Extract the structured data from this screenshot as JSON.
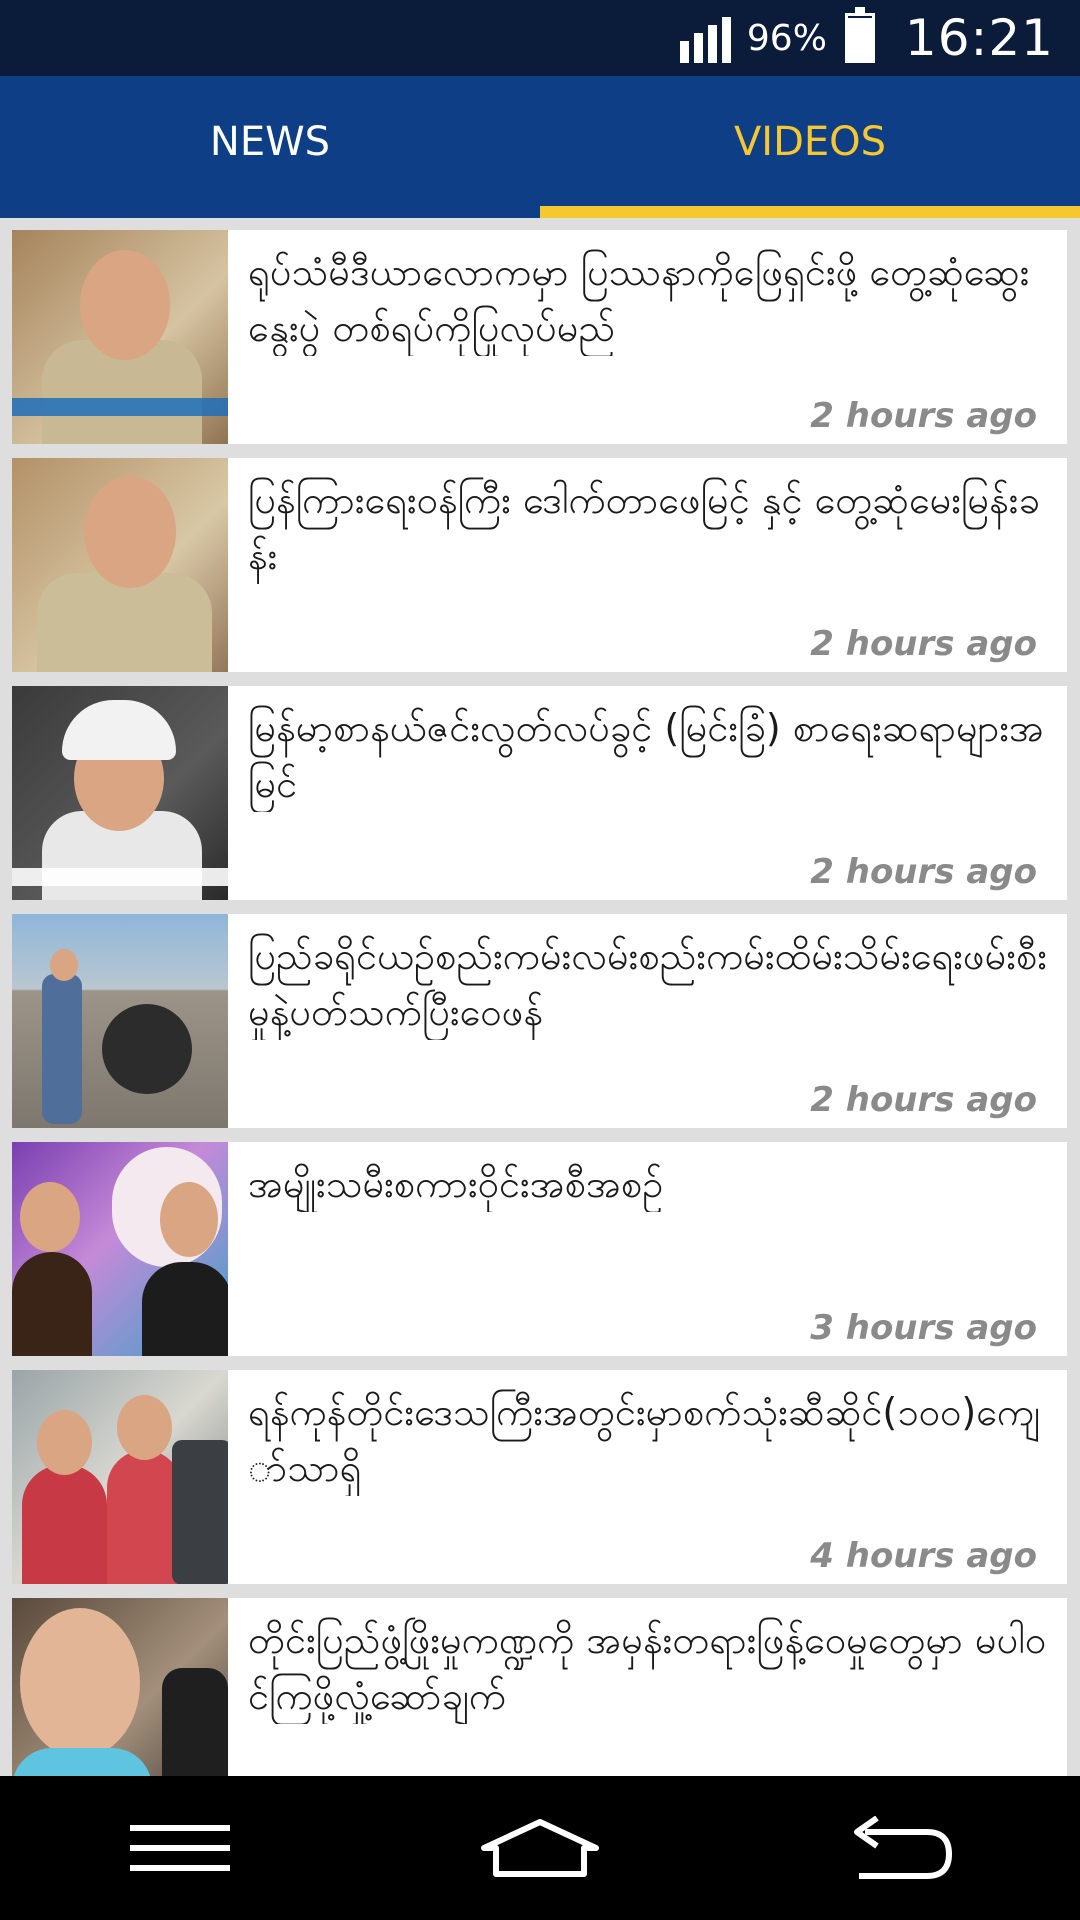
{
  "status_bar": {
    "battery_percent": "96%",
    "time": "16:21",
    "battery_level": 0.96,
    "signal_bars": 4
  },
  "tabs": [
    {
      "label": "NEWS",
      "active": false
    },
    {
      "label": "VIDEOS",
      "active": true
    }
  ],
  "colors": {
    "status_bar_bg": "#0b1c3a",
    "tab_bar_bg": "#0e3e86",
    "accent": "#f7c730",
    "timestamp": "#8a8a8a"
  },
  "videos": [
    {
      "title": "ရုပ်သံမီဒီယာလောကမှာ ပြဿနာကိုဖြေရှင်းဖို့ တွေ့ဆုံဆွေးနွေးပွဲ တစ်ရပ်ကိုပြုလုပ်မည်",
      "time": "2 hours ago"
    },
    {
      "title": "ပြန်ကြားရေးဝန်ကြီး ဒေါက်တာဖေမြင့် နှင့် တွေ့ဆုံမေးမြန်းခန်း",
      "time": "2 hours ago"
    },
    {
      "title": "မြန်မာ့စာနယ်ဇင်းလွတ်လပ်ခွင့် (မြင်းခြံ) စာရေးဆရာများအမြင်",
      "time": "2 hours ago"
    },
    {
      "title": "ပြည်ခရိုင်ယဥ်စည်းကမ်းလမ်းစည်းကမ်းထိမ်းသိမ်းရေးဖမ်းစီးမှုနဲ့ပတ်သက်ပြီးဝေဖန်",
      "time": "2 hours ago"
    },
    {
      "title": "အမျိုးသမီးစကားဝိုင်းအစီအစဉ်",
      "time": "3 hours ago"
    },
    {
      "title": "ရန်ကုန်တိုင်းဒေသကြီးအတွင်းမှာစက်သုံးဆီဆိုင်(၁၀၀)ကျော်သာရှိ",
      "time": "4 hours ago"
    },
    {
      "title": "တိုင်းပြည်ဖွံ့ဖြိုးမှုကဏ္ဍကို အမှန်းတရားဖြန့်ဝေမှုတွေမှာ မပါဝင်ကြဖို့လှုံ့ဆော်ချက်",
      "time": ""
    }
  ]
}
